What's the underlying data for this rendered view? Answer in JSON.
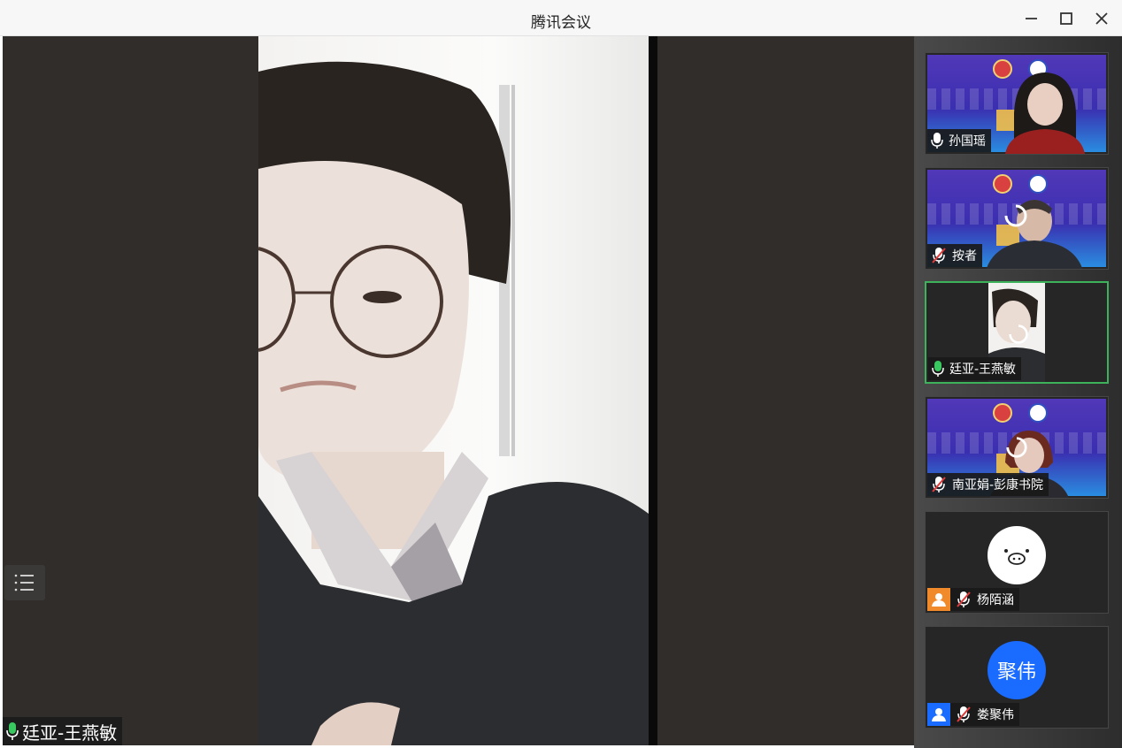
{
  "window": {
    "title": "腾讯会议",
    "minimize_icon": "minimize-icon",
    "maximize_icon": "maximize-icon",
    "close_icon": "close-icon"
  },
  "main_view": {
    "speaker_name": "廷亚-王燕敏",
    "mic_icon": "mic-on-icon",
    "list_toggle_icon": "list-icon"
  },
  "participants": [
    {
      "name": "孙国瑶",
      "mic": "on",
      "video": "on",
      "background": "banner"
    },
    {
      "name": "按者",
      "mic": "muted",
      "video": "on",
      "background": "banner"
    },
    {
      "name": "廷亚-王燕敏",
      "mic": "on",
      "video": "on",
      "active": true
    },
    {
      "name": "南亚娟-彭康书院",
      "mic": "muted",
      "video": "on",
      "background": "banner"
    },
    {
      "name": "杨陌涵",
      "mic": "muted",
      "video": "off",
      "avatar": "pig-face-icon",
      "badge_color": "#f08a2a"
    },
    {
      "name": "娄聚伟",
      "mic": "muted",
      "video": "off",
      "avatar_text": "聚伟",
      "avatar_color": "#1a6bff",
      "badge_color": "#1a6bff"
    }
  ],
  "colors": {
    "active_border": "#3db25a",
    "muted_red": "#e03a3a",
    "mic_green": "#39c860",
    "accent_blue": "#1a6bff"
  }
}
